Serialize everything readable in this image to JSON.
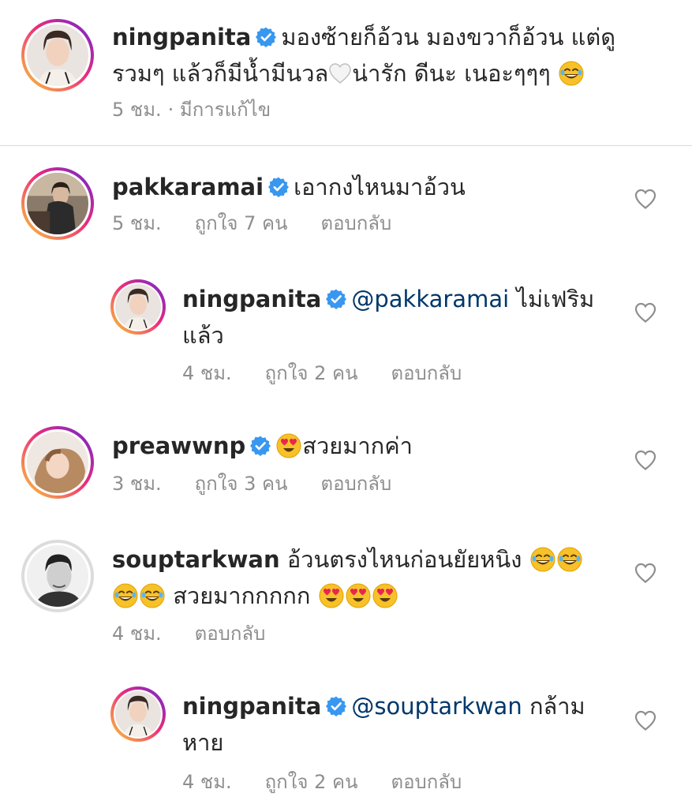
{
  "caption": {
    "username": "ningpanita",
    "text_line1": "มองซ้ายก็อ้วน มองขวาก็อ้วน แต่ดู",
    "text_line2a": "รวมๆ แล้วก็มีน้ำมีนวล",
    "text_line2b": "น่ารัก ดีนะ เนอะๆๆๆ",
    "time": "5 ชม.",
    "edited": "· มีการแก้ไข"
  },
  "comments": [
    {
      "username": "pakkaramai",
      "text": "เอากงไหนมาอ้วน",
      "time": "5 ชม.",
      "likes": "ถูกใจ 7 คน",
      "reply": "ตอบกลับ"
    },
    {
      "username": "ningpanita",
      "mention": "@pakkaramai",
      "text_line1": "ไม่เฟริม",
      "text_line2": "แล้ว",
      "time": "4 ชม.",
      "likes": "ถูกใจ 2 คน",
      "reply": "ตอบกลับ"
    },
    {
      "username": "preawwnp",
      "text": "สวยมากค่า",
      "time": "3 ชม.",
      "likes": "ถูกใจ 3 คน",
      "reply": "ตอบกลับ"
    },
    {
      "username": "souptarkwan",
      "text_line1": "อ้วนตรงไหนก่อนยัยหนิง",
      "text_line2": "สวยมากกกกก",
      "time": "4 ชม.",
      "reply": "ตอบกลับ"
    },
    {
      "username": "ningpanita",
      "mention": "@souptarkwan",
      "text_line1": "กล้าม",
      "text_line2": "หาย",
      "time": "4 ชม.",
      "likes": "ถูกใจ 2 คน",
      "reply": "ตอบกลับ"
    }
  ],
  "colors": {
    "verified": "#3897f0",
    "mention": "#00376b",
    "meta": "#8e8e8e",
    "text": "#262626"
  },
  "icons": {
    "verified": "verified-badge-icon",
    "like": "heart-outline-icon",
    "rofl": "rofl-emoji",
    "joy": "joy-emoji",
    "heart_eyes": "heart-eyes-emoji",
    "white_heart": "white-heart-emoji"
  }
}
